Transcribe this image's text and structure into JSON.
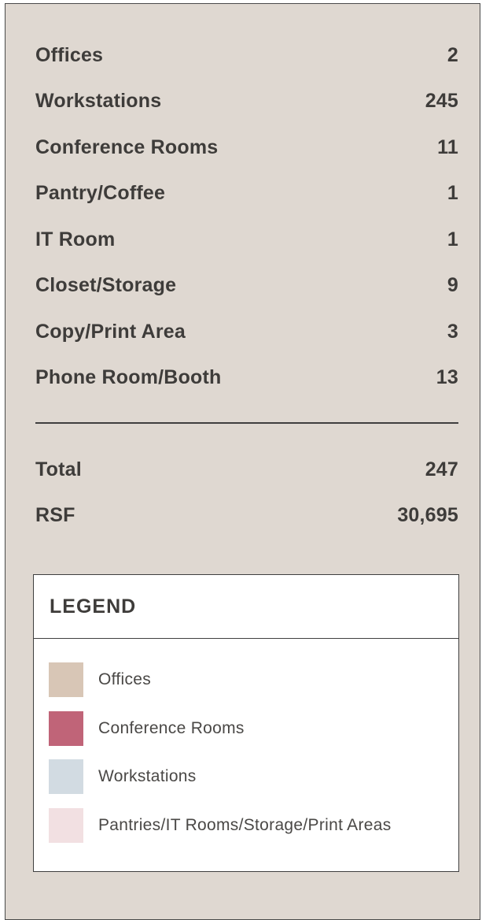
{
  "rooms": [
    {
      "label": "Offices",
      "value": "2"
    },
    {
      "label": "Workstations",
      "value": "245"
    },
    {
      "label": "Conference Rooms",
      "value": "11"
    },
    {
      "label": "Pantry/Coffee",
      "value": "1"
    },
    {
      "label": "IT Room",
      "value": "1"
    },
    {
      "label": "Closet/Storage",
      "value": "9"
    },
    {
      "label": "Copy/Print Area",
      "value": "3"
    },
    {
      "label": "Phone Room/Booth",
      "value": "13"
    }
  ],
  "totals": [
    {
      "label": "Total",
      "value": "247"
    },
    {
      "label": "RSF",
      "value": "30,695"
    }
  ],
  "legend": {
    "title": "LEGEND",
    "items": [
      {
        "label": "Offices",
        "color": "#d8c6b6"
      },
      {
        "label": "Conference Rooms",
        "color": "#c06478"
      },
      {
        "label": "Workstations",
        "color": "#d2dbe2"
      },
      {
        "label": "Pantries/IT Rooms/Storage/Print Areas",
        "color": "#f2e0e2"
      }
    ]
  }
}
